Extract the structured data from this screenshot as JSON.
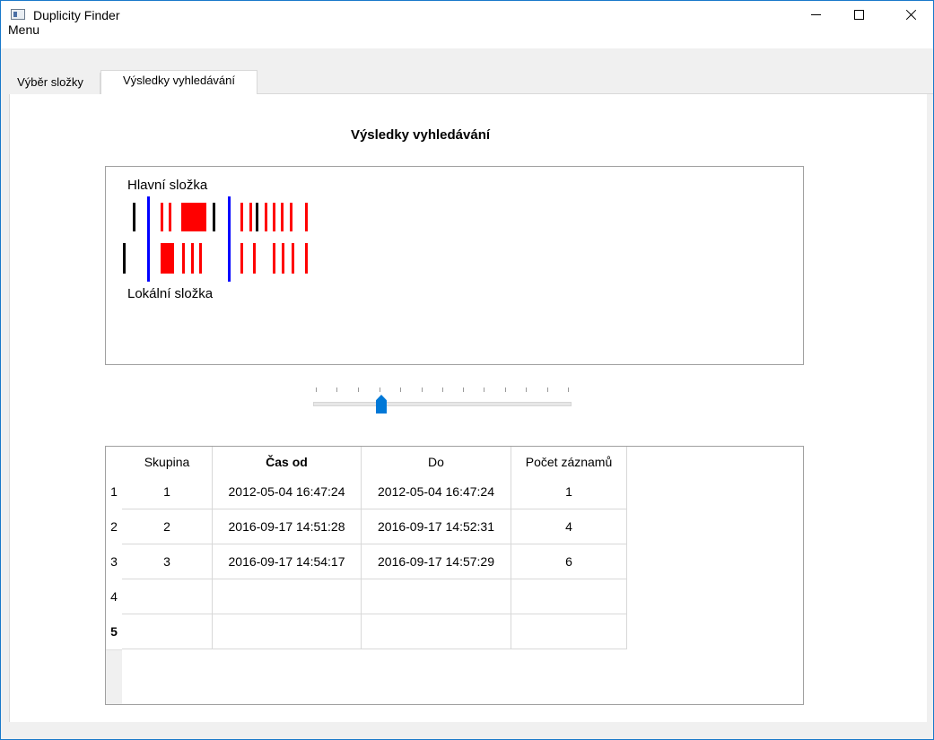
{
  "window": {
    "title": "Duplicity Finder"
  },
  "menu": {
    "label": "Menu"
  },
  "tabs": [
    {
      "label": "Výběr složky",
      "active": false
    },
    {
      "label": "Výsledky vyhledávání",
      "active": true
    }
  ],
  "results": {
    "heading": "Výsledky vyhledávání",
    "timeline": {
      "top_label": "Hlavní složka",
      "bottom_label": "Lokální složka",
      "colors": {
        "black": "#000000",
        "blue": "#0000ff",
        "red": "#ff0000"
      }
    },
    "slider": {
      "ticks": 13,
      "position": 3
    }
  },
  "table": {
    "columns": [
      "Skupina",
      "Čas od",
      "Do",
      "Počet záznamů"
    ],
    "row_headers": [
      "1",
      "2",
      "3",
      "4",
      "5"
    ],
    "rows": [
      [
        "1",
        "2012-05-04 16:47:24",
        "2012-05-04 16:47:24",
        "1"
      ],
      [
        "2",
        "2016-09-17 14:51:28",
        "2016-09-17 14:52:31",
        "4"
      ],
      [
        "3",
        "2016-09-17 14:54:17",
        "2016-09-17 14:57:29",
        "6"
      ],
      [
        "",
        "",
        "",
        ""
      ],
      [
        "",
        "",
        "",
        ""
      ]
    ]
  }
}
